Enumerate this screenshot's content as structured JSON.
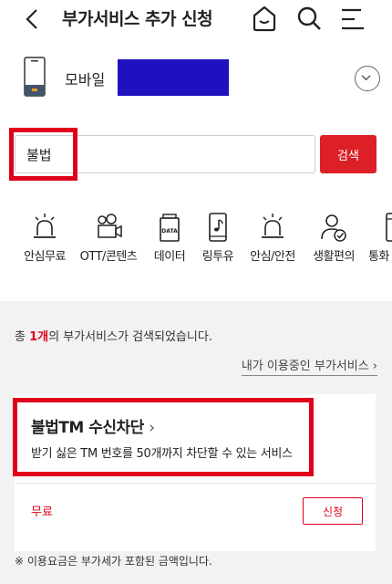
{
  "header": {
    "title": "부가서비스 추가 신청",
    "icons": [
      "back-arrow-icon",
      "home-icon",
      "search-icon",
      "menu-icon"
    ]
  },
  "device": {
    "label": "모바일"
  },
  "search": {
    "value": "불법",
    "button_label": "검색"
  },
  "categories": [
    {
      "label": "안심무료",
      "icon": "alarm-bell-icon"
    },
    {
      "label": "OTT/콘텐츠",
      "icon": "film-camera-icon"
    },
    {
      "label": "데이터",
      "icon": "data-card-icon"
    },
    {
      "label": "링투유",
      "icon": "phone-music-icon"
    },
    {
      "label": "안심/안전",
      "icon": "alarm-bell-icon"
    },
    {
      "label": "생활편의",
      "icon": "person-check-icon"
    },
    {
      "label": "통화",
      "icon": "phone-icon"
    }
  ],
  "results": {
    "prefix": "총 ",
    "count": "1개",
    "suffix": "의 부가서비스가 검색되었습니다.",
    "my_services_link": "내가 이용중인 부가서비스"
  },
  "service_card": {
    "title": "불법TM 수신차단",
    "description": "받기 싫은 TM 번호를 50개까지 차단할 수 있는 서비스",
    "price": "무료",
    "apply_label": "신청"
  },
  "footnote": "※ 이용요금은 부가세가 포함된 금액입니다.",
  "colors": {
    "accent": "#dd1f26",
    "redaction": "#1f11c0"
  }
}
